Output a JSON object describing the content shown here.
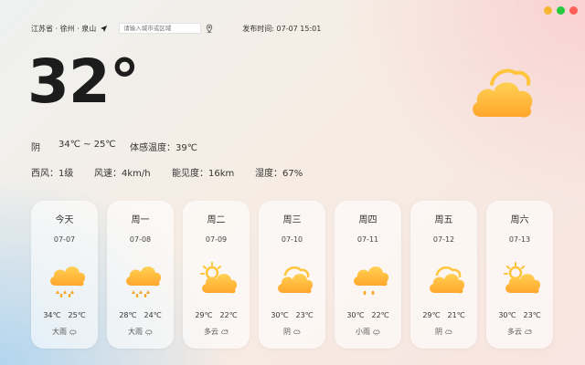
{
  "location": {
    "text": "江苏省 · 徐州 · 泉山"
  },
  "search": {
    "placeholder": "请输入城市或区域"
  },
  "publish": {
    "label": "发布时间:",
    "time": "07-07 15:01"
  },
  "current": {
    "temperature": "32°",
    "condition": "阴",
    "range": "34℃ ~ 25℃",
    "feels_like": "体感温度：39℃",
    "wind_dir": "西风：1级",
    "wind_speed": "风速：4km/h",
    "visibility": "能见度：16km",
    "humidity": "湿度：67%",
    "icon": "cloudy-icon"
  },
  "window_controls": {
    "colors": [
      "#f7b731",
      "#27c93f",
      "#ff5f56"
    ]
  },
  "colors": {
    "icon_sun": "#ffc53d",
    "icon_cloud_top": "#ffd155",
    "icon_cloud_bottom": "#ffa62b",
    "rain": "#f5a623"
  },
  "forecast": [
    {
      "day": "今天",
      "date": "07-07",
      "high": "34℃",
      "low": "25℃",
      "condition": "大雨",
      "icon": "rain"
    },
    {
      "day": "周一",
      "date": "07-08",
      "high": "28℃",
      "low": "24℃",
      "condition": "大雨",
      "icon": "rain"
    },
    {
      "day": "周二",
      "date": "07-09",
      "high": "29℃",
      "low": "22℃",
      "condition": "多云",
      "icon": "partly-cloudy"
    },
    {
      "day": "周三",
      "date": "07-10",
      "high": "30℃",
      "low": "23℃",
      "condition": "阴",
      "icon": "overcast"
    },
    {
      "day": "周四",
      "date": "07-11",
      "high": "30℃",
      "low": "22℃",
      "condition": "小雨",
      "icon": "light-rain"
    },
    {
      "day": "周五",
      "date": "07-12",
      "high": "29℃",
      "low": "21℃",
      "condition": "阴",
      "icon": "overcast"
    },
    {
      "day": "周六",
      "date": "07-13",
      "high": "30℃",
      "low": "23℃",
      "condition": "多云",
      "icon": "partly-cloudy"
    }
  ]
}
